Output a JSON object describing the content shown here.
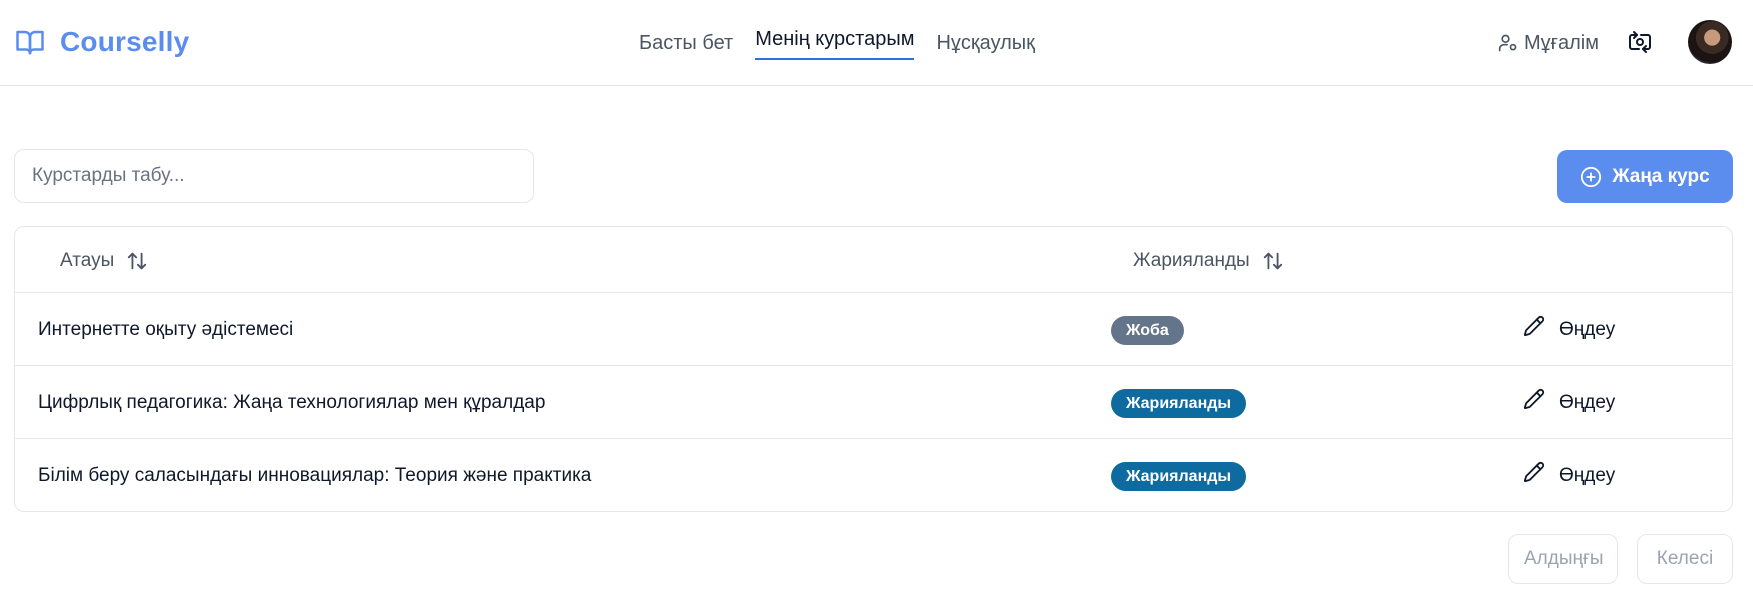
{
  "header": {
    "brand": "Courselly",
    "nav": [
      {
        "label": "Басты бет",
        "active": false
      },
      {
        "label": "Менің курстарым",
        "active": true
      },
      {
        "label": "Нұсқаулық",
        "active": false
      }
    ],
    "role_label": "Мұғалім",
    "brand_icon": "book-open-icon",
    "role_icon": "user-cog-icon",
    "camera_icon": "switch-camera-icon"
  },
  "toolbar": {
    "search_placeholder": "Курстарды табу...",
    "new_course_label": "Жаңа курс",
    "new_course_icon": "plus-circle-icon"
  },
  "table": {
    "columns": [
      {
        "label": "Атауы",
        "sortable": true
      },
      {
        "label": "Жарияланды",
        "sortable": true
      }
    ],
    "rows": [
      {
        "title": "Интернетте оқыту әдістемесі",
        "status": "Жоба",
        "status_kind": "draft",
        "action": "Өңдеу"
      },
      {
        "title": "Цифрлық педагогика: Жаңа технологиялар мен құралдар",
        "status": "Жарияланды",
        "status_kind": "published",
        "action": "Өңдеу"
      },
      {
        "title": "Білім беру саласындағы инновациялар: Теория және практика",
        "status": "Жарияланды",
        "status_kind": "published",
        "action": "Өңдеу"
      }
    ]
  },
  "pagination": {
    "prev_label": "Алдыңғы",
    "next_label": "Келесі",
    "prev_enabled": false,
    "next_enabled": false
  },
  "colors": {
    "accent": "#5b8def",
    "active_underline": "#2f6fde",
    "badge_draft": "#64748b",
    "badge_published": "#0e6ba0",
    "border": "#e5e7eb"
  }
}
